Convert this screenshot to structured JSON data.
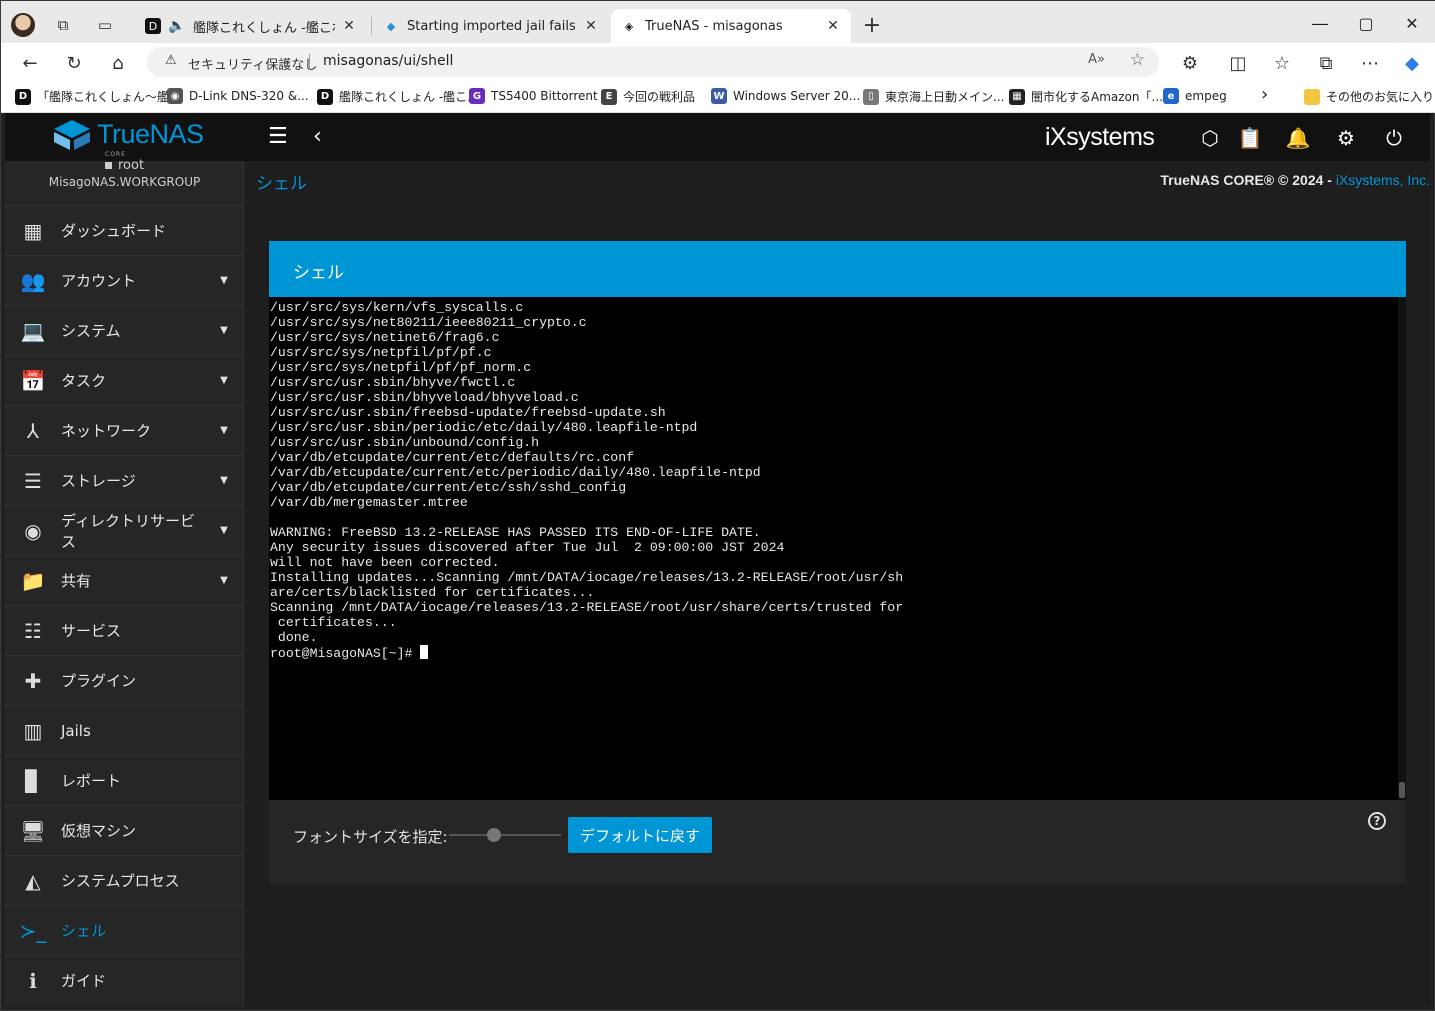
{
  "browser": {
    "tabs": [
      {
        "title": "艦隊これくしょん -艦これ- - オン",
        "favicon": "D",
        "audio": true
      },
      {
        "title": "Starting imported jail fails becaus",
        "favicon": "◆"
      },
      {
        "title": "TrueNAS - misagonas",
        "favicon": "◈",
        "active": true
      }
    ],
    "new_tab": "+",
    "address": {
      "security": "セキュリティ保護なし",
      "url": "misagonas/ui/shell",
      "read_aloud": "A»"
    },
    "bookmarks": [
      {
        "label": "「艦隊これくしょん～艦...",
        "icon": "D",
        "color": "#111"
      },
      {
        "label": "D-Link DNS-320 &...",
        "icon": "◉",
        "color": "#555"
      },
      {
        "label": "艦隊これくしょん -艦こ...",
        "icon": "D",
        "color": "#111"
      },
      {
        "label": "TS5400 Bittorrent",
        "icon": "G",
        "color": "#6a2bbf"
      },
      {
        "label": "今回の戦利品",
        "icon": "E",
        "color": "#444"
      },
      {
        "label": "Windows Server 20...",
        "icon": "W",
        "color": "#3c5aa6"
      },
      {
        "label": "東京海上日動メイン...",
        "icon": "▯",
        "color": "#777"
      },
      {
        "label": "闇市化するAmazon「...",
        "icon": "▦",
        "color": "#222"
      },
      {
        "label": "empeg",
        "icon": "e",
        "color": "#2266cc"
      }
    ],
    "bookmarks_more": "›",
    "other_bookmarks": "その他のお気に入り"
  },
  "app": {
    "logo_text": "TrueNAS",
    "logo_sub": "CORE",
    "vendor_logo": "iXsystems",
    "user": {
      "name": "root",
      "host": "MisagoNAS.WORKGROUP"
    },
    "menu": [
      {
        "label": "ダッシュボード",
        "icon": "▦",
        "caret": false
      },
      {
        "label": "アカウント",
        "icon": "👥",
        "caret": true
      },
      {
        "label": "システム",
        "icon": "💻",
        "caret": true
      },
      {
        "label": "タスク",
        "icon": "📅",
        "caret": true
      },
      {
        "label": "ネットワーク",
        "icon": "⅄",
        "caret": true
      },
      {
        "label": "ストレージ",
        "icon": "☰",
        "caret": true
      },
      {
        "label": "ディレクトリサービス",
        "icon": "◉",
        "caret": true
      },
      {
        "label": "共有",
        "icon": "📁",
        "caret": true
      },
      {
        "label": "サービス",
        "icon": "☷",
        "caret": false
      },
      {
        "label": "プラグイン",
        "icon": "✚",
        "caret": false
      },
      {
        "label": "Jails",
        "icon": "▥",
        "caret": false
      },
      {
        "label": "レポート",
        "icon": "▊",
        "caret": false
      },
      {
        "label": "仮想マシン",
        "icon": "🖥",
        "caret": false
      },
      {
        "label": "システムプロセス",
        "icon": "◭",
        "caret": false
      },
      {
        "label": "シェル",
        "icon": "≻_",
        "caret": false,
        "active": true
      },
      {
        "label": "ガイド",
        "icon": "ℹ",
        "caret": false
      }
    ],
    "breadcrumb": "シェル",
    "copyright": "TrueNAS CORE® © 2024 - ",
    "copyright_link": "iXsystems, Inc.",
    "card_title": "シェル",
    "terminal_lines": [
      "/usr/src/sys/kern/vfs_syscalls.c",
      "/usr/src/sys/net80211/ieee80211_crypto.c",
      "/usr/src/sys/netinet6/frag6.c",
      "/usr/src/sys/netpfil/pf/pf.c",
      "/usr/src/sys/netpfil/pf/pf_norm.c",
      "/usr/src/usr.sbin/bhyve/fwctl.c",
      "/usr/src/usr.sbin/bhyveload/bhyveload.c",
      "/usr/src/usr.sbin/freebsd-update/freebsd-update.sh",
      "/usr/src/usr.sbin/periodic/etc/daily/480.leapfile-ntpd",
      "/usr/src/usr.sbin/unbound/config.h",
      "/var/db/etcupdate/current/etc/defaults/rc.conf",
      "/var/db/etcupdate/current/etc/periodic/daily/480.leapfile-ntpd",
      "/var/db/etcupdate/current/etc/ssh/sshd_config",
      "/var/db/mergemaster.mtree",
      "",
      "WARNING: FreeBSD 13.2-RELEASE HAS PASSED ITS END-OF-LIFE DATE.",
      "Any security issues discovered after Tue Jul  2 09:00:00 JST 2024",
      "will not have been corrected.",
      "Installing updates...Scanning /mnt/DATA/iocage/releases/13.2-RELEASE/root/usr/sh",
      "are/certs/blacklisted for certificates...",
      "Scanning /mnt/DATA/iocage/releases/13.2-RELEASE/root/usr/share/certs/trusted for",
      " certificates...",
      " done."
    ],
    "prompt": "root@MisagoNAS[~]# ",
    "font_size_label": "フォントサイズを指定:",
    "font_size_level": 0.4,
    "reset_button": "デフォルトに戻す"
  }
}
